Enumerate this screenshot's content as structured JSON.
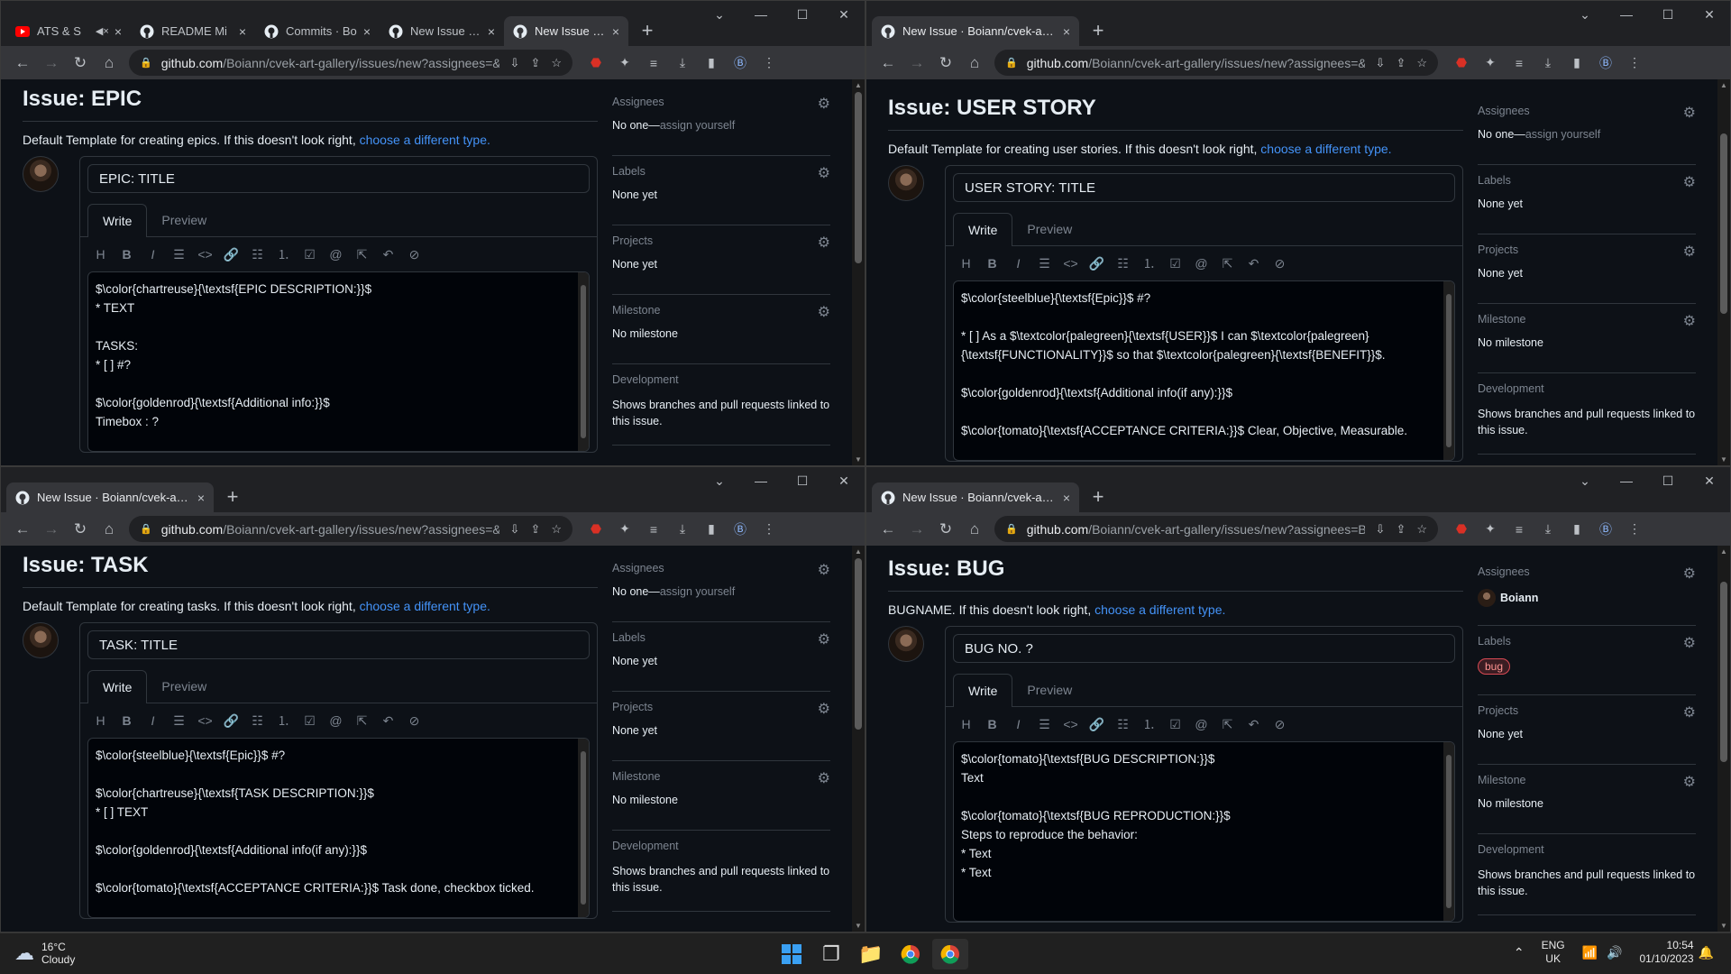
{
  "windows": [
    {
      "tabs": [
        {
          "title": "ATS & S",
          "icon": "youtube-icon",
          "muted": true,
          "active": false
        },
        {
          "title": "README Mi",
          "icon": "github-icon",
          "active": false
        },
        {
          "title": "Commits · Bo",
          "icon": "github-icon",
          "active": false
        },
        {
          "title": "New Issue · B",
          "icon": "github-icon",
          "active": false
        },
        {
          "title": "New Issue · B",
          "icon": "github-icon",
          "active": true
        }
      ],
      "url_domain": "github.com",
      "url_path": "/Boiann/cvek-art-gallery/issues/new?assignees=&labels=&...",
      "issue_title": "Issue: EPIC",
      "description": "Default Template for creating epics. If this doesn't look right,",
      "link": "choose a different type.",
      "title_value": "EPIC: TITLE",
      "write_label": "Write",
      "preview_label": "Preview",
      "body": "$\\color{chartreuse}{\\textsf{EPIC DESCRIPTION:}}$\n* TEXT\n\nTASKS:\n* [ ] #?\n\n$\\color{goldenrod}{\\textsf{Additional info:}}$\nTimebox : ?",
      "assignees_heading": "Assignees",
      "assignees_value": "No one—",
      "assignees_link": "assign yourself",
      "labels_heading": "Labels",
      "labels_value": "None yet",
      "projects_heading": "Projects",
      "projects_value": "None yet",
      "milestone_heading": "Milestone",
      "milestone_value": "No milestone",
      "development_heading": "Development",
      "development_value": "Shows branches and pull requests linked to this issue."
    },
    {
      "tabs": [
        {
          "title": "New Issue · Boiann/cvek-art-gall",
          "icon": "github-icon",
          "active": true
        }
      ],
      "url_domain": "github.com",
      "url_path": "/Boiann/cvek-art-gallery/issues/new?assignees=&labels=&...",
      "issue_title": "Issue: USER STORY",
      "description": "Default Template for creating user stories. If this doesn't look right,",
      "link": "choose a different type.",
      "title_value": "USER STORY: TITLE",
      "write_label": "Write",
      "preview_label": "Preview",
      "body": "$\\color{steelblue}{\\textsf{Epic}}$ #?\n\n* [ ] As a $\\textcolor{palegreen}{\\textsf{USER}}$ I can $\\textcolor{palegreen}{\\textsf{FUNCTIONALITY}}$ so that $\\textcolor{palegreen}{\\textsf{BENEFIT}}$.\n\n$\\color{goldenrod}{\\textsf{Additional info(if any):}}$\n\n$\\color{tomato}{\\textsf{ACCEPTANCE CRITERIA:}}$ Clear, Objective, Measurable.",
      "assignees_heading": "Assignees",
      "assignees_value": "No one—",
      "assignees_link": "assign yourself",
      "labels_heading": "Labels",
      "labels_value": "None yet",
      "projects_heading": "Projects",
      "projects_value": "None yet",
      "milestone_heading": "Milestone",
      "milestone_value": "No milestone",
      "development_heading": "Development",
      "development_value": "Shows branches and pull requests linked to this issue."
    },
    {
      "tabs": [
        {
          "title": "New Issue · Boiann/cvek-art-gall",
          "icon": "github-icon",
          "active": true
        }
      ],
      "url_domain": "github.com",
      "url_path": "/Boiann/cvek-art-gallery/issues/new?assignees=&labels=&...",
      "issue_title": "Issue: TASK",
      "description": "Default Template for creating tasks. If this doesn't look right,",
      "link": "choose a different type.",
      "title_value": "TASK: TITLE",
      "write_label": "Write",
      "preview_label": "Preview",
      "body": "$\\color{steelblue}{\\textsf{Epic}}$ #?\n\n$\\color{chartreuse}{\\textsf{TASK DESCRIPTION:}}$\n* [ ] TEXT\n\n$\\color{goldenrod}{\\textsf{Additional info(if any):}}$\n\n$\\color{tomato}{\\textsf{ACCEPTANCE CRITERIA:}}$ Task done, checkbox ticked.",
      "assignees_heading": "Assignees",
      "assignees_value": "No one—",
      "assignees_link": "assign yourself",
      "labels_heading": "Labels",
      "labels_value": "None yet",
      "projects_heading": "Projects",
      "projects_value": "None yet",
      "milestone_heading": "Milestone",
      "milestone_value": "No milestone",
      "development_heading": "Development",
      "development_value": "Shows branches and pull requests linked to this issue."
    },
    {
      "tabs": [
        {
          "title": "New Issue · Boiann/cvek-art-gall",
          "icon": "github-icon",
          "active": true
        }
      ],
      "url_domain": "github.com",
      "url_path": "/Boiann/cvek-art-gallery/issues/new?assignees=Boiann&la...",
      "issue_title": "Issue: BUG",
      "description": "BUGNAME. If this doesn't look right,",
      "link": "choose a different type.",
      "title_value": "BUG NO. ?",
      "write_label": "Write",
      "preview_label": "Preview",
      "body": "$\\color{tomato}{\\textsf{BUG DESCRIPTION:}}$\nText\n\n$\\color{tomato}{\\textsf{BUG REPRODUCTION:}}$\nSteps to reproduce the behavior:\n* Text\n* Text",
      "assignees_heading": "Assignees",
      "assignee_name": "Boiann",
      "labels_heading": "Labels",
      "label_badge": "bug",
      "projects_heading": "Projects",
      "projects_value": "None yet",
      "milestone_heading": "Milestone",
      "milestone_value": "No milestone",
      "development_heading": "Development",
      "development_value": "Shows branches and pull requests linked to this issue."
    }
  ],
  "taskbar": {
    "temp": "16°C",
    "condition": "Cloudy",
    "lang_top": "ENG",
    "lang_bottom": "UK",
    "time": "10:54",
    "date": "01/10/2023"
  },
  "colors": {
    "bg": "#0d1117",
    "link": "#4493f8",
    "border": "#30363d",
    "muted": "#7d8590",
    "bug_label": "#d94a54"
  }
}
